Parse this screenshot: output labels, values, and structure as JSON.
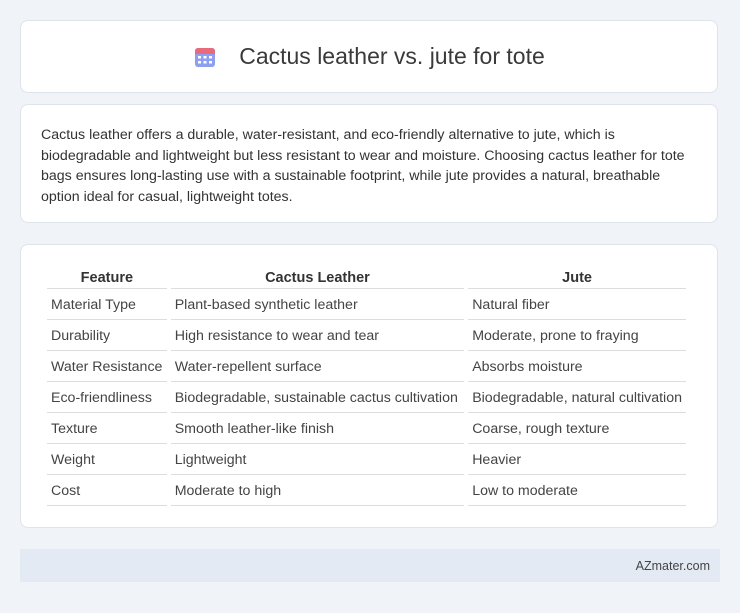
{
  "header": {
    "title": "Cactus leather vs. jute for tote",
    "icon": "calendar-icon"
  },
  "summary": {
    "text": "Cactus leather offers a durable, water-resistant, and eco-friendly alternative to jute, which is biodegradable and lightweight but less resistant to wear and moisture. Choosing cactus leather for tote bags ensures long-lasting use with a sustainable footprint, while jute provides a natural, breathable option ideal for casual, lightweight totes."
  },
  "table": {
    "headers": [
      "Feature",
      "Cactus Leather",
      "Jute"
    ],
    "rows": [
      [
        "Material Type",
        "Plant-based synthetic leather",
        "Natural fiber"
      ],
      [
        "Durability",
        "High resistance to wear and tear",
        "Moderate, prone to fraying"
      ],
      [
        "Water Resistance",
        "Water-repellent surface",
        "Absorbs moisture"
      ],
      [
        "Eco-friendliness",
        "Biodegradable, sustainable cactus cultivation",
        "Biodegradable, natural cultivation"
      ],
      [
        "Texture",
        "Smooth leather-like finish",
        "Coarse, rough texture"
      ],
      [
        "Weight",
        "Lightweight",
        "Heavier"
      ],
      [
        "Cost",
        "Moderate to high",
        "Low to moderate"
      ]
    ]
  },
  "footer": {
    "text": "AZmater.com"
  },
  "colors": {
    "background": "#f0f3f8",
    "card": "#ffffff",
    "footer": "#e4eaf4",
    "icon_top": "#e05a6b",
    "icon_body": "#6b7fd7"
  }
}
